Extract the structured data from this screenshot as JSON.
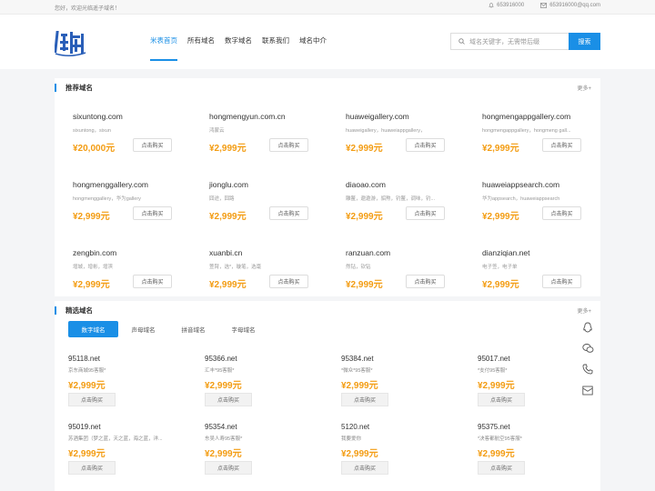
{
  "topbar": {
    "welcome": "您好，欢迎光临遥子域名！",
    "phone": "653916000",
    "email": "653916000@qq.com"
  },
  "header": {
    "logo_text": "遥子域名",
    "nav": [
      {
        "label": "米表首页",
        "active": true
      },
      {
        "label": "所有域名",
        "active": false
      },
      {
        "label": "数字域名",
        "active": false
      },
      {
        "label": "联系我们",
        "active": false
      },
      {
        "label": "域名中介",
        "active": false
      }
    ],
    "search_placeholder": "域名关键字，无需带后缀",
    "search_button": "搜索"
  },
  "recommended": {
    "title": "推荐域名",
    "more": "更多+",
    "buy_label": "点击购买",
    "items": [
      {
        "name": "sixuntong.com",
        "desc": "sixuntong，sixun",
        "price": "¥20,000元"
      },
      {
        "name": "hongmengyun.com.cn",
        "desc": "鸿蒙云",
        "price": "¥2,999元"
      },
      {
        "name": "huaweigallery.com",
        "desc": "huaweigallery，huaweiappgallery，",
        "price": "¥2,999元"
      },
      {
        "name": "hongmengappgallery.com",
        "desc": "hongmengappgallery，hongmeng gall...",
        "price": "¥2,999元"
      },
      {
        "name": "hongmenggallery.com",
        "desc": "hongmenggallery，华为gallery",
        "price": "¥2,999元"
      },
      {
        "name": "jionglu.com",
        "desc": "囧途，囧路",
        "price": "¥2,999元"
      },
      {
        "name": "diaoao.com",
        "desc": "雕鳌，遨遨游，貂熬，钓鳌，调味，钓...",
        "price": "¥2,999元"
      },
      {
        "name": "huaweiappsearch.com",
        "desc": "华为appsearch，huaweiappsearch",
        "price": "¥2,999元"
      },
      {
        "name": "zengbin.com",
        "desc": "增城，增彬，增滨",
        "price": "¥2,999元"
      },
      {
        "name": "xuanbi.cn",
        "desc": "萱臂，选*，璇笔，选毫",
        "price": "¥2,999元"
      },
      {
        "name": "ranzuan.com",
        "desc": "然钻，钦钻",
        "price": "¥2,999元"
      },
      {
        "name": "dianziqian.net",
        "desc": "电子签，电子单",
        "price": "¥2,999元"
      }
    ]
  },
  "selected": {
    "title": "精选域名",
    "more": "更多+",
    "buy_label": "点击购买",
    "tabs": [
      {
        "label": "数字域名",
        "active": true
      },
      {
        "label": "声母域名",
        "active": false
      },
      {
        "label": "拼音域名",
        "active": false
      },
      {
        "label": "字母域名",
        "active": false
      }
    ],
    "items": [
      {
        "name": "95118.net",
        "desc": "京东商城95客服*",
        "price": "¥2,999元"
      },
      {
        "name": "95366.net",
        "desc": "汇丰*95客服*",
        "price": "¥2,999元"
      },
      {
        "name": "95384.net",
        "desc": "*微众*95客服*",
        "price": "¥2,999元"
      },
      {
        "name": "95017.net",
        "desc": "*支付95客服*",
        "price": "¥2,999元"
      },
      {
        "name": "95019.net",
        "desc": "苏酒集团（梦之蓝，天之蓝，海之蓝，洋...",
        "price": "¥2,999元"
      },
      {
        "name": "95354.net",
        "desc": "东吴人寿95客服*",
        "price": "¥2,999元"
      },
      {
        "name": "5120.net",
        "desc": "我要爱你",
        "price": "¥2,999元"
      },
      {
        "name": "95375.net",
        "desc": "*决客都航空95客服*",
        "price": "¥2,999元"
      }
    ]
  },
  "float_icons": [
    "qq-icon",
    "wechat-icon",
    "phone-icon",
    "mail-icon"
  ],
  "colors": {
    "accent": "#1a8fe6",
    "price": "#f39c12"
  }
}
